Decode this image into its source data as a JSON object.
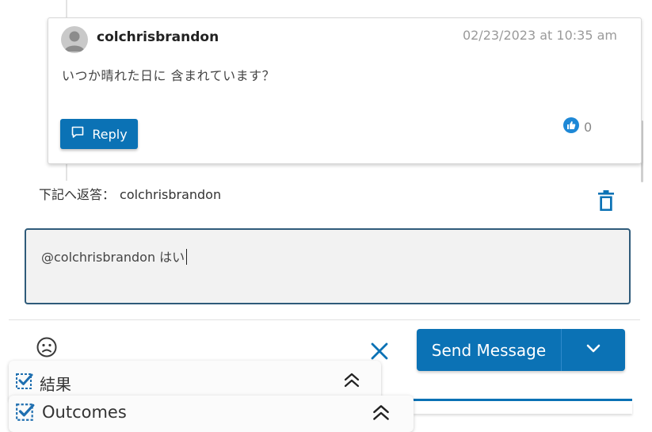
{
  "comment": {
    "username": "colchrisbrandon",
    "timestamp": "02/23/2023 at 10:35 am",
    "body": "いつか晴れた日に 含まれています？",
    "reply_label": "Reply",
    "like_count": "0"
  },
  "composer": {
    "reply_to_prefix": "下記へ返答：",
    "reply_to_name": "colchrisbrandon",
    "message_text": "@colchrisbrandon はい",
    "send_label": "Send Message"
  },
  "panels": [
    {
      "label": "結果"
    },
    {
      "label": "Outcomes"
    }
  ],
  "colors": {
    "primary": "#0b72b5",
    "input_border": "#2f5b7a",
    "input_bg": "#f2f2f2"
  },
  "icons": {
    "avatar": "user-avatar-icon",
    "reply": "speech-bubble-icon",
    "like": "thumbs-up-icon",
    "delete": "trash-icon",
    "emoji": "smiley-icon",
    "clear": "close-icon",
    "dropdown": "chevron-down-icon",
    "checkbox": "checked-box-icon",
    "collapse": "double-chevron-up-icon"
  }
}
